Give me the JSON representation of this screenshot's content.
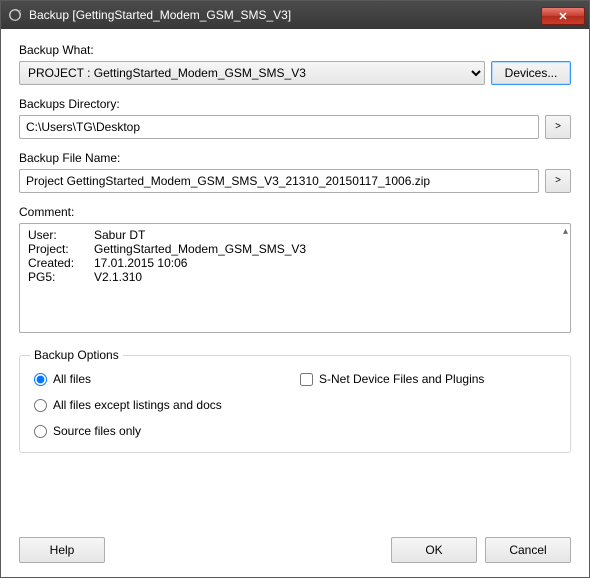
{
  "window": {
    "title": "Backup [GettingStarted_Modem_GSM_SMS_V3]"
  },
  "labels": {
    "backup_what": "Backup What:",
    "backups_directory": "Backups Directory:",
    "backup_file_name": "Backup File Name:",
    "comment": "Comment:"
  },
  "backup_what": {
    "selected": "PROJECT : GettingStarted_Modem_GSM_SMS_V3"
  },
  "devices_button": "Devices...",
  "backups_directory": "C:\\Users\\TG\\Desktop",
  "backup_file_name": "Project GettingStarted_Modem_GSM_SMS_V3_21310_20150117_1006.zip",
  "comment": {
    "rows": [
      {
        "key": "User:",
        "value": "Sabur DT"
      },
      {
        "key": "Project:",
        "value": "GettingStarted_Modem_GSM_SMS_V3"
      },
      {
        "key": "Created:",
        "value": "17.01.2015 10:06"
      },
      {
        "key": "PG5:",
        "value": "V2.1.310"
      }
    ]
  },
  "options": {
    "legend": "Backup Options",
    "all_files": "All files",
    "all_except": "All files except listings and docs",
    "source_only": "Source files only",
    "snet": "S-Net Device Files and Plugins",
    "selected": "all_files",
    "snet_checked": false
  },
  "buttons": {
    "help": "Help",
    "ok": "OK",
    "cancel": "Cancel",
    "browse": ">"
  }
}
